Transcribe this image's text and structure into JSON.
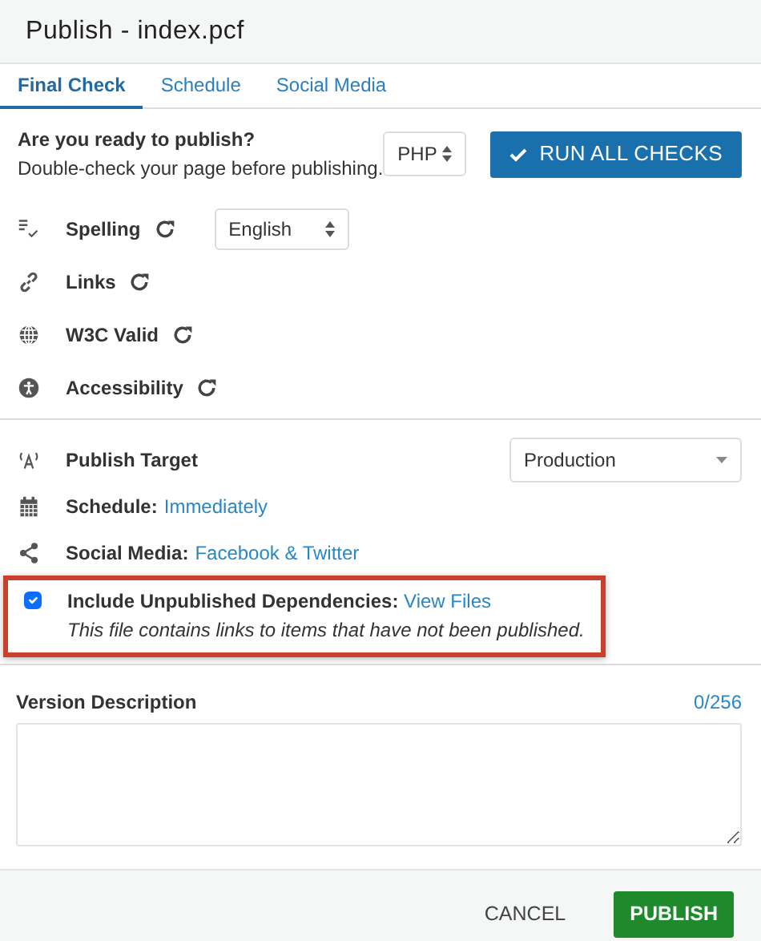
{
  "window": {
    "title": "Publish - index.pcf"
  },
  "tabs": [
    {
      "label": "Final Check",
      "selected": true
    },
    {
      "label": "Schedule",
      "selected": false
    },
    {
      "label": "Social Media",
      "selected": false
    }
  ],
  "ready": {
    "title": "Are you ready to publish?",
    "subtitle": "Double-check your page before publishing.",
    "select_value": "PHP",
    "run_button": "RUN ALL CHECKS"
  },
  "checks": [
    {
      "kind": "select",
      "label": "Spelling",
      "value": "English"
    },
    {
      "kind": "plain",
      "label": "Links"
    },
    {
      "kind": "plain",
      "label": "W3C Valid"
    },
    {
      "kind": "plain",
      "label": "Accessibility"
    }
  ],
  "options": [
    {
      "kind": "select",
      "label": "Publish Target",
      "value": "Production"
    },
    {
      "kind": "link",
      "label": "Schedule:",
      "link": "Immediately"
    },
    {
      "kind": "link",
      "label": "Social Media:",
      "link": "Facebook & Twitter"
    }
  ],
  "dependencies": {
    "checked": true,
    "highlighted": true,
    "label": "Include Unpublished Dependencies:",
    "link": "View Files",
    "note": "This file contains links to items that have not been published."
  },
  "version": {
    "label": "Version Description",
    "counter": "0/256"
  },
  "footer": {
    "cancel": "CANCEL",
    "publish": "PUBLISH"
  }
}
